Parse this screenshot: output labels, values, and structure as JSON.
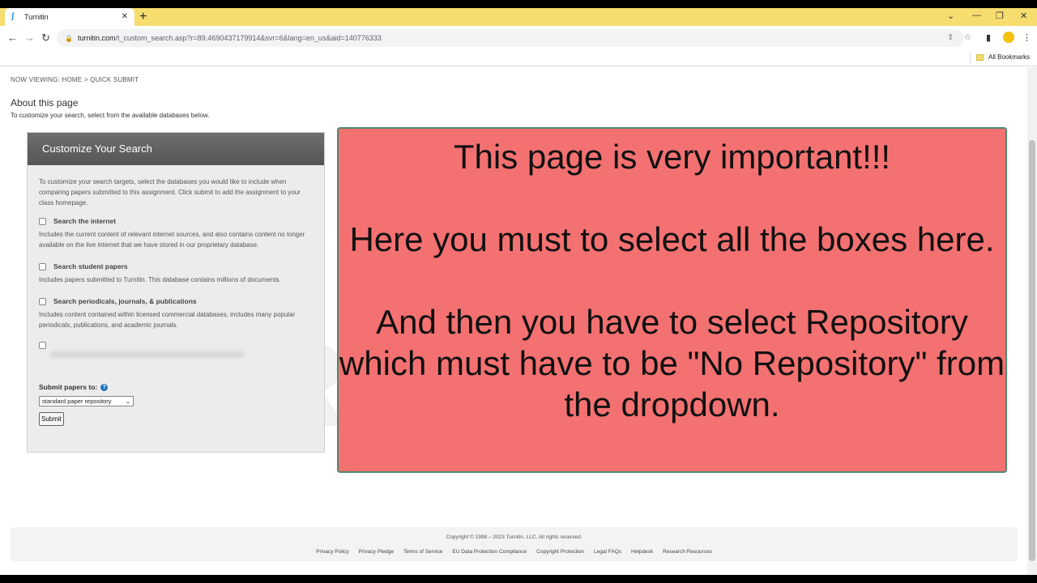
{
  "browser": {
    "tab_title": "Turnitin",
    "tab_favicon": "turnitin-logo-icon",
    "url_host": "turnitin.com",
    "url_path": "/t_custom_search.asp?r=89.4690437179914&svr=6&lang=en_us&aid=140776333",
    "bookmarks_label": "All Bookmarks"
  },
  "page": {
    "breadcrumb_prefix": "NOW VIEWING:",
    "breadcrumb_home": "HOME",
    "breadcrumb_sep": ">",
    "breadcrumb_current": "QUICK SUBMIT",
    "about_title": "About this page",
    "about_desc": "To customize your search, select from the available databases below."
  },
  "panel": {
    "title": "Customize Your Search",
    "intro": "To customize your search targets, select the databases you would like to include when comparing papers submitted to this assignment. Click submit to add the assignment to your class homepage.",
    "options": [
      {
        "label": "Search the internet",
        "desc": "Includes the current content of relevant internet sources, and also contains content no longer available on the live internet that we have stored in our proprietary database.",
        "checked": false
      },
      {
        "label": "Search student papers",
        "desc": "Includes papers submitted to Turnitin. This database contains millions of documents.",
        "checked": false
      },
      {
        "label": "Search periodicals, journals, & publications",
        "desc": "Includes content contained within licensed commercial databases, includes many popular periodicals, publications, and academic journals.",
        "checked": false
      }
    ],
    "submit_to_label": "Submit papers to:",
    "repository_selected": "standard paper repository",
    "submit_button": "Submit"
  },
  "notice": {
    "line1": "This page is very important!!!",
    "line2": "Here you must to select all the boxes here.",
    "line3": "And then you have to select Repository which must have to be \"No Repository\" from the dropdown."
  },
  "watermark": {
    "top": "TGQ",
    "bottom": "SERVICES"
  },
  "footer": {
    "copyright": "Copyright © 1998 – 2023 Turnitin, LLC. All rights reserved.",
    "links": [
      "Privacy Policy",
      "Privacy Pledge",
      "Terms of Service",
      "EU Data Protection Compliance",
      "Copyright Protection",
      "Legal FAQs",
      "Helpdesk",
      "Research Resources"
    ]
  },
  "colors": {
    "notice_bg": "#f47171",
    "notice_border": "#4d8a6e",
    "tabstrip": "#f6dd6e",
    "panel_header": "#5f5f5f"
  }
}
